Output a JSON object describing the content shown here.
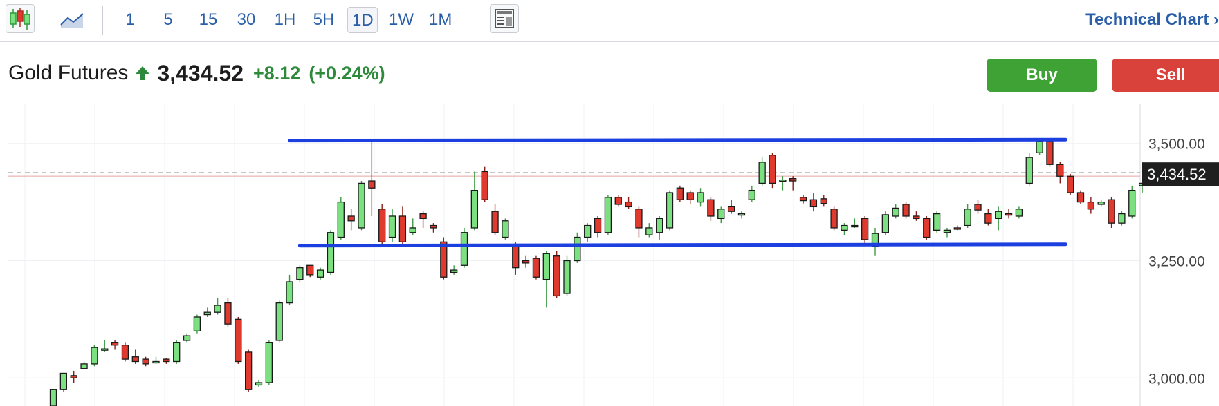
{
  "toolbar": {
    "chart_type_icon": "candlestick-icon",
    "line_type_icon": "line-chart-icon",
    "intervals": [
      "1",
      "5",
      "15",
      "30",
      "1H",
      "5H",
      "1D",
      "1W",
      "1M"
    ],
    "active_interval": "1D",
    "layout_icon": "layout-panel-icon",
    "technical_chart_label": "Technical Chart",
    "technical_chart_arrow": "›"
  },
  "quote": {
    "name": "Gold Futures",
    "direction_icon": "up-arrow-icon",
    "price": "3,434.52",
    "change": "+8.12",
    "change_pct": "(+0.24%)",
    "up_color": "#2e8a3b"
  },
  "actions": {
    "buy_label": "Buy",
    "sell_label": "Sell",
    "buy_color": "#3ea334",
    "sell_color": "#d9423a"
  },
  "chart_data": {
    "type": "candlestick",
    "y_axis": {
      "ticks": [
        "3,500.00",
        "3,250.00",
        "3,000.00"
      ],
      "tick_values": [
        3500,
        3250,
        3000
      ],
      "ylim": [
        2940,
        3585
      ]
    },
    "last_price_label": "3,434.52",
    "last_price": 3434.52,
    "grid": true,
    "colors": {
      "up": "#7be07f",
      "down": "#e03a2e",
      "trendline": "#1c3fe0",
      "price_line": "#666666"
    },
    "trendlines": [
      {
        "from_index": 23,
        "to_index": 98,
        "from_value": 3506,
        "to_value": 3508
      },
      {
        "from_index": 24,
        "to_index": 98,
        "from_value": 3282,
        "to_value": 3285
      }
    ],
    "candles": [
      [
        2940,
        2975,
        2935,
        2975
      ],
      [
        2975,
        3010,
        2970,
        3005
      ],
      [
        3005,
        3000,
        2990,
        3015
      ],
      [
        3020,
        3030,
        3018,
        3035
      ],
      [
        3030,
        3065,
        3025,
        3070
      ],
      [
        3060,
        3062,
        3055,
        3080
      ],
      [
        3075,
        3070,
        3060,
        3080
      ],
      [
        3070,
        3040,
        3035,
        3075
      ],
      [
        3045,
        3035,
        3030,
        3060
      ],
      [
        3040,
        3030,
        3025,
        3045
      ],
      [
        3035,
        3035,
        3030,
        3045
      ],
      [
        3040,
        3035,
        3030,
        3042
      ],
      [
        3035,
        3075,
        3030,
        3080
      ],
      [
        3080,
        3090,
        3075,
        3095
      ],
      [
        3100,
        3130,
        3095,
        3135
      ],
      [
        3135,
        3140,
        3130,
        3150
      ],
      [
        3140,
        3155,
        3135,
        3170
      ],
      [
        3160,
        3115,
        3110,
        3170
      ],
      [
        3125,
        3035,
        3030,
        3130
      ],
      [
        3055,
        2975,
        2970,
        3060
      ],
      [
        2985,
        2990,
        2980,
        2995
      ],
      [
        2990,
        3075,
        2985,
        3080
      ],
      [
        3080,
        3160,
        3075,
        3165
      ],
      [
        3160,
        3205,
        3155,
        3220
      ],
      [
        3210,
        3235,
        3205,
        3240
      ],
      [
        3240,
        3220,
        3215,
        3240
      ],
      [
        3215,
        3230,
        3210,
        3235
      ],
      [
        3225,
        3310,
        3220,
        3315
      ],
      [
        3300,
        3375,
        3295,
        3385
      ],
      [
        3345,
        3335,
        3315,
        3360
      ],
      [
        3320,
        3415,
        3315,
        3420
      ],
      [
        3420,
        3405,
        3345,
        3505
      ],
      [
        3360,
        3290,
        3280,
        3370
      ],
      [
        3300,
        3345,
        3290,
        3360
      ],
      [
        3345,
        3290,
        3280,
        3365
      ],
      [
        3310,
        3320,
        3305,
        3340
      ],
      [
        3350,
        3340,
        3320,
        3355
      ],
      [
        3325,
        3320,
        3310,
        3330
      ],
      [
        3290,
        3215,
        3210,
        3300
      ],
      [
        3225,
        3230,
        3220,
        3240
      ],
      [
        3240,
        3310,
        3235,
        3320
      ],
      [
        3320,
        3400,
        3315,
        3440
      ],
      [
        3440,
        3380,
        3375,
        3450
      ],
      [
        3355,
        3310,
        3305,
        3370
      ],
      [
        3300,
        3335,
        3295,
        3340
      ],
      [
        3285,
        3235,
        3220,
        3290
      ],
      [
        3250,
        3245,
        3235,
        3260
      ],
      [
        3255,
        3215,
        3210,
        3260
      ],
      [
        3210,
        3265,
        3150,
        3270
      ],
      [
        3260,
        3175,
        3170,
        3270
      ],
      [
        3180,
        3250,
        3175,
        3260
      ],
      [
        3250,
        3300,
        3245,
        3310
      ],
      [
        3300,
        3325,
        3290,
        3330
      ],
      [
        3340,
        3310,
        3300,
        3345
      ],
      [
        3310,
        3385,
        3305,
        3390
      ],
      [
        3385,
        3370,
        3365,
        3390
      ],
      [
        3375,
        3365,
        3360,
        3385
      ],
      [
        3360,
        3320,
        3300,
        3365
      ],
      [
        3305,
        3320,
        3300,
        3330
      ],
      [
        3310,
        3340,
        3295,
        3345
      ],
      [
        3320,
        3395,
        3315,
        3400
      ],
      [
        3405,
        3380,
        3375,
        3410
      ],
      [
        3395,
        3380,
        3370,
        3400
      ],
      [
        3375,
        3395,
        3365,
        3405
      ],
      [
        3380,
        3345,
        3335,
        3385
      ],
      [
        3340,
        3360,
        3330,
        3365
      ],
      [
        3365,
        3355,
        3350,
        3380
      ],
      [
        3350,
        3350,
        3340,
        3355
      ],
      [
        3380,
        3400,
        3375,
        3410
      ],
      [
        3415,
        3460,
        3410,
        3470
      ],
      [
        3475,
        3415,
        3405,
        3480
      ],
      [
        3420,
        3422,
        3400,
        3430
      ],
      [
        3425,
        3420,
        3400,
        3430
      ],
      [
        3385,
        3378,
        3372,
        3390
      ],
      [
        3380,
        3365,
        3355,
        3395
      ],
      [
        3382,
        3372,
        3365,
        3390
      ],
      [
        3360,
        3320,
        3315,
        3365
      ],
      [
        3315,
        3325,
        3305,
        3330
      ],
      [
        3325,
        3325,
        3320,
        3340
      ],
      [
        3340,
        3295,
        3285,
        3345
      ],
      [
        3280,
        3308,
        3260,
        3320
      ],
      [
        3310,
        3348,
        3305,
        3355
      ],
      [
        3345,
        3362,
        3340,
        3370
      ],
      [
        3370,
        3345,
        3340,
        3375
      ],
      [
        3345,
        3340,
        3335,
        3355
      ],
      [
        3340,
        3300,
        3295,
        3345
      ],
      [
        3315,
        3350,
        3310,
        3355
      ],
      [
        3310,
        3315,
        3300,
        3320
      ],
      [
        3320,
        3318,
        3315,
        3325
      ],
      [
        3325,
        3360,
        3320,
        3370
      ],
      [
        3370,
        3358,
        3350,
        3380
      ],
      [
        3350,
        3330,
        3325,
        3360
      ],
      [
        3340,
        3355,
        3315,
        3365
      ],
      [
        3350,
        3348,
        3340,
        3360
      ],
      [
        3345,
        3360,
        3340,
        3365
      ],
      [
        3415,
        3470,
        3410,
        3480
      ],
      [
        3480,
        3505,
        3475,
        3510
      ],
      [
        3505,
        3455,
        3450,
        3510
      ],
      [
        3455,
        3430,
        3415,
        3460
      ],
      [
        3430,
        3395,
        3390,
        3435
      ],
      [
        3395,
        3375,
        3370,
        3400
      ],
      [
        3375,
        3360,
        3350,
        3385
      ],
      [
        3370,
        3375,
        3365,
        3380
      ],
      [
        3380,
        3330,
        3320,
        3385
      ],
      [
        3330,
        3350,
        3325,
        3355
      ],
      [
        3345,
        3400,
        3340,
        3410
      ],
      [
        3410,
        3415,
        3395,
        3425
      ],
      [
        3420,
        3430,
        3420,
        3440
      ],
      [
        3432,
        3436,
        3430,
        3438
      ]
    ]
  }
}
